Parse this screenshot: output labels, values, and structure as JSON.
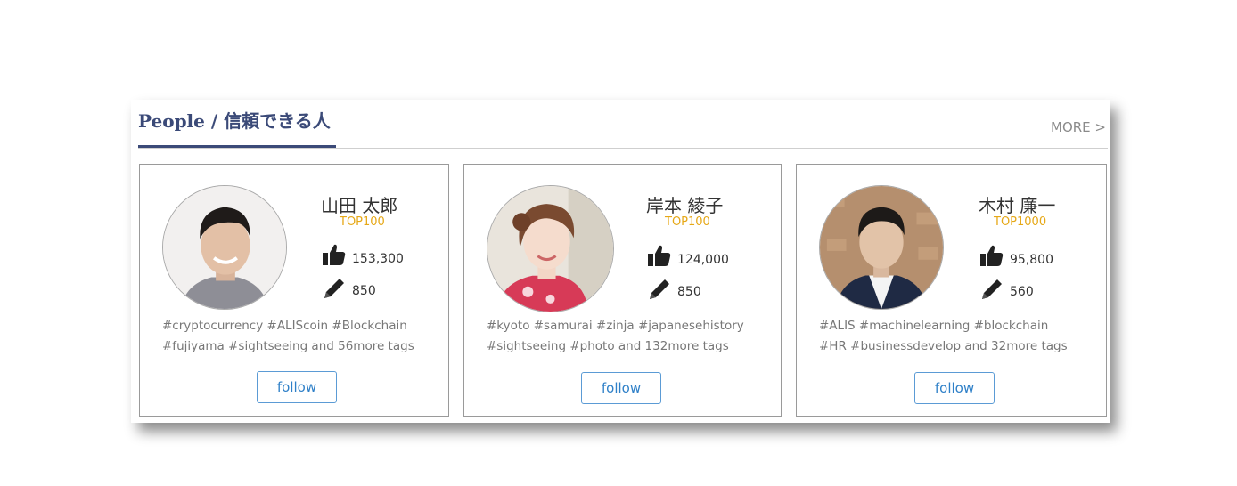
{
  "section": {
    "title": "People / 信頼できる人",
    "more_label": "MORE >"
  },
  "cards": [
    {
      "name": "山田 太郎",
      "rank": "TOP100",
      "likes": "153,300",
      "articles": "850",
      "tags_line1": "#cryptocurrency #ALIScoin #Blockchain",
      "tags_line2": "#fujiyama #sightseeing and 56more tags",
      "follow_label": "follow"
    },
    {
      "name": "岸本 綾子",
      "rank": "TOP100",
      "likes": "124,000",
      "articles": "850",
      "tags_line1": "#kyoto #samurai #zinja #japanesehistory",
      "tags_line2": "#sightseeing #photo and 132more tags",
      "follow_label": "follow"
    },
    {
      "name": "木村 廉一",
      "rank": "TOP1000",
      "likes": "95,800",
      "articles": "560",
      "tags_line1": "#ALIS #machinelearning #blockchain",
      "tags_line2": "#HR #businessdevelop and 32more tags",
      "follow_label": "follow"
    }
  ],
  "colors": {
    "title": "#3b4a78",
    "rank": "#e6a817",
    "follow": "#2f80c8",
    "tags": "#777777"
  },
  "icons": {
    "likes": "thumbs-up-icon",
    "articles": "pencil-icon"
  }
}
